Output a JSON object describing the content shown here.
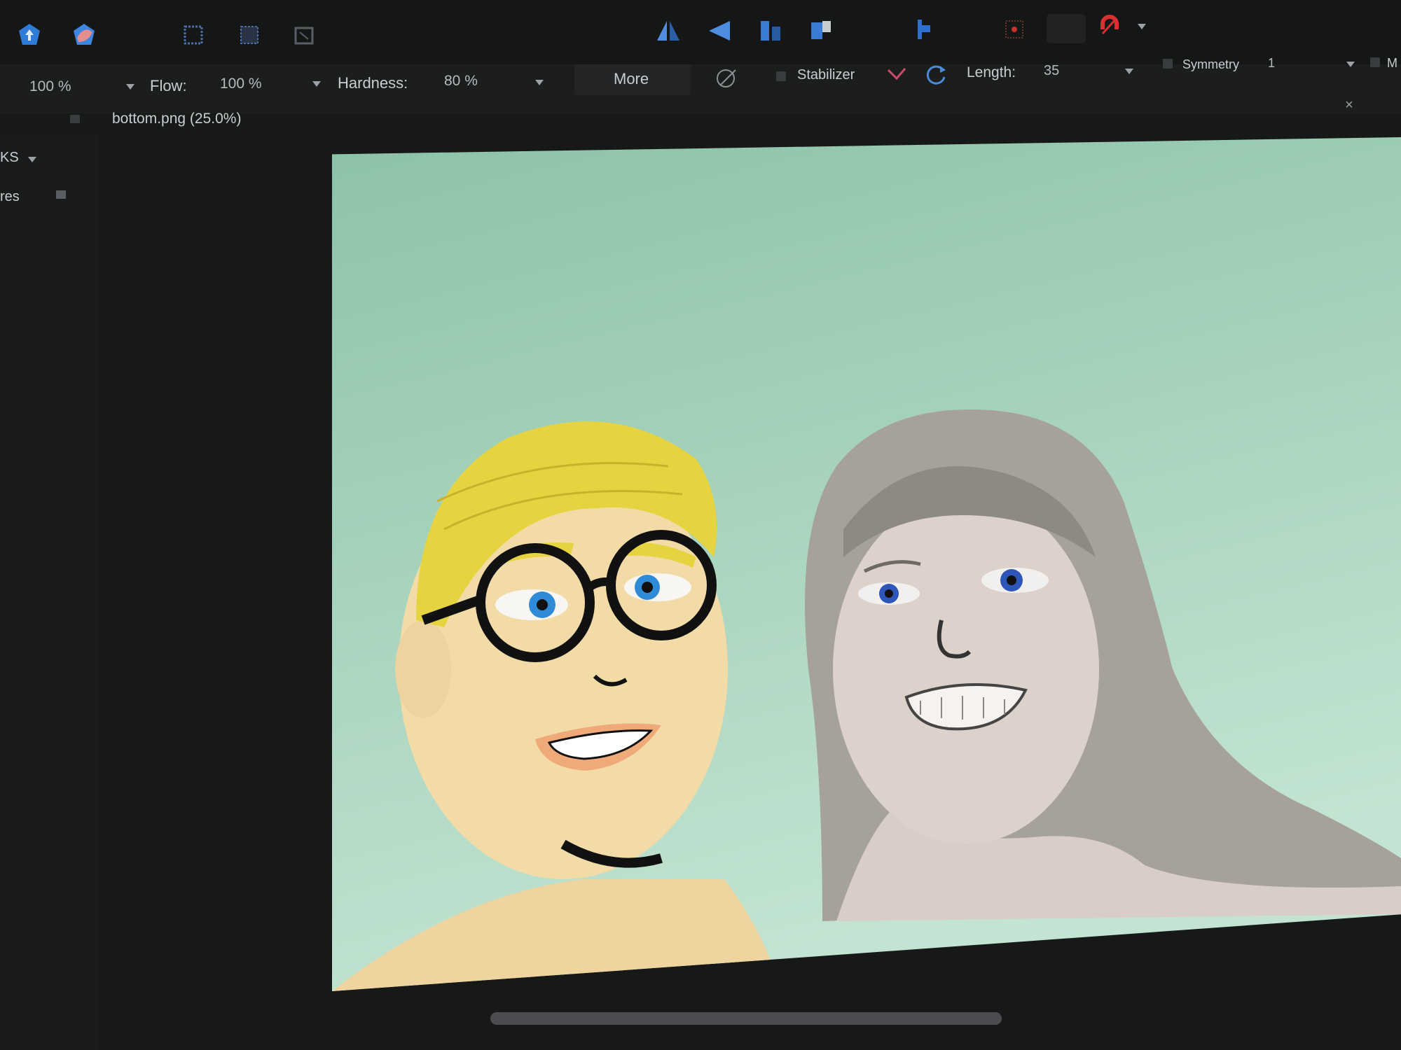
{
  "toolbar": {
    "icons": [
      "persona-photo-icon",
      "persona-pixel-icon",
      "marquee-select-icon",
      "selection-brush-icon",
      "transform-icon",
      "flip-horizontal-icon",
      "flip-vertical-icon",
      "align-icon",
      "arrange-icon",
      "snapping-icon",
      "grid-icon",
      "magnet-icon"
    ]
  },
  "context_bar": {
    "opacity_value": "100 %",
    "flow_label": "Flow:",
    "flow_value": "100 %",
    "hardness_label": "Hardness:",
    "hardness_value": "80 %",
    "more_label": "More",
    "stabilizer_label": "Stabilizer",
    "length_label": "Length:",
    "length_value": "35",
    "symmetry_label": "Symmetry",
    "symmetry_value": "1",
    "mirror_label": "M"
  },
  "document": {
    "tab_title": "bottom.png (25.0%)"
  },
  "left_panel": {
    "item1": "KS",
    "item2": "res"
  },
  "colors": {
    "canvas_bg_top": "#8cc2a8",
    "canvas_bg_bottom": "#bfe0cf",
    "skin_left": "#f1d9a3",
    "skin_right": "#dbd2cb",
    "hair_left": "#e6d34a",
    "hair_right": "#9a958f",
    "eye_blue": "#2f6fd0"
  }
}
